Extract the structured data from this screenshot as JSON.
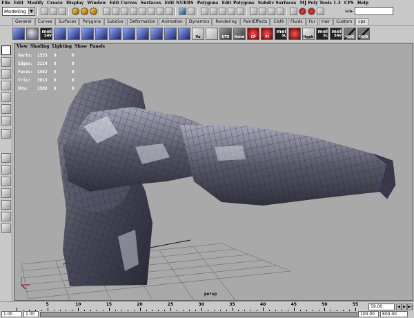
{
  "menubar": [
    "File",
    "Edit",
    "Modify",
    "Create",
    "Display",
    "Window",
    "Edit Curves",
    "Surfaces",
    "Edit NURBS",
    "Polygons",
    "Edit Polygons",
    "Subdiv Surfaces",
    "MJ Poly Tools 1.3",
    "CPS",
    "Help"
  ],
  "statusline": {
    "mode": "Modeling",
    "sel_label": "sel▸"
  },
  "shelf_tabs": [
    "General",
    "Curves",
    "Surfaces",
    "Polygons",
    "Subdivs",
    "Deformation",
    "Animation",
    "Dynamics",
    "Rendering",
    "PaintEffects",
    "Cloth",
    "Fluids",
    "Fur",
    "Hair",
    "Custom",
    "cps"
  ],
  "shelf_active_tab": "cps",
  "shelf_buttons": [
    {
      "label": "",
      "icon": "poly-cube-icon",
      "style": "cube"
    },
    {
      "label": "",
      "icon": "poly-sphere-icon",
      "style": "sphere"
    },
    {
      "label": "mel SAV",
      "icon": "mel-save-icon",
      "style": "mel"
    },
    {
      "label": "",
      "icon": "cube-icon",
      "style": "cube"
    },
    {
      "label": "",
      "icon": "cube-icon",
      "style": "cube"
    },
    {
      "label": "",
      "icon": "cube-icon",
      "style": "cube"
    },
    {
      "label": "",
      "icon": "cube-icon",
      "style": "cube"
    },
    {
      "label": "",
      "icon": "cube-icon",
      "style": "cube"
    },
    {
      "label": "",
      "icon": "cube-icon",
      "style": "cube"
    },
    {
      "label": "",
      "icon": "cube-icon",
      "style": "cube"
    },
    {
      "label": "",
      "icon": "cube-icon",
      "style": "cube"
    },
    {
      "label": "",
      "icon": "cube-icon",
      "style": "cube"
    },
    {
      "label": "",
      "icon": "cube-icon",
      "style": "cube"
    },
    {
      "label": "Vu",
      "icon": "view-icon",
      "style": "light"
    },
    {
      "label": "",
      "icon": "grid-icon",
      "style": "light"
    },
    {
      "label": "UTE",
      "icon": "ute-icon",
      "style": "grey"
    },
    {
      "label": "Hshd",
      "icon": "hshd-icon",
      "style": "grey"
    },
    {
      "label": "CP",
      "icon": "cp-icon",
      "style": "red"
    },
    {
      "label": "FI",
      "icon": "fi-icon",
      "style": "red"
    },
    {
      "label": "mel SL",
      "icon": "mel-sl-icon",
      "style": "mel"
    },
    {
      "label": "",
      "icon": "target-icon",
      "style": "red"
    },
    {
      "label": "Hgph",
      "icon": "hgph-icon",
      "style": "light"
    },
    {
      "label": "mel SL",
      "icon": "mel-sl-icon",
      "style": "mel"
    },
    {
      "label": "mel SAV",
      "icon": "mel-save-icon",
      "style": "mel"
    },
    {
      "label": "HUO",
      "icon": "huo-icon",
      "style": "stripe"
    },
    {
      "label": "HUO",
      "icon": "huo-icon",
      "style": "stripe"
    }
  ],
  "panel_menu": [
    "View",
    "Shading",
    "Lighting",
    "Show",
    "Panels"
  ],
  "hud": [
    {
      "label": "Verts:",
      "v1": "1553",
      "v2": "0",
      "v3": "0"
    },
    {
      "label": "Edges:",
      "v1": "3114",
      "v2": "0",
      "v3": "0"
    },
    {
      "label": "Faces:",
      "v1": "1562",
      "v2": "0",
      "v3": "0"
    },
    {
      "label": "Tris:",
      "v1": "3013",
      "v2": "0",
      "v3": "0"
    },
    {
      "label": "UVs:",
      "v1": "1588",
      "v2": "0",
      "v3": "0"
    }
  ],
  "camera_label": "persp",
  "timeline": {
    "ticks": [
      "5",
      "10",
      "15",
      "20",
      "25",
      "30",
      "35",
      "40",
      "45",
      "50",
      "55"
    ],
    "current_frame": "59.00"
  },
  "range": {
    "start": "1.00",
    "inner_start": "1.00",
    "inner_end": "100.00",
    "end": "800.00"
  },
  "colors": {
    "ui_gray": "#c8c8c8",
    "viewport_bg": "#a9a9a9",
    "wire": "#1a1a7a",
    "mesh_dark": "#3a3a44",
    "mesh_light": "#d8d8e0"
  }
}
